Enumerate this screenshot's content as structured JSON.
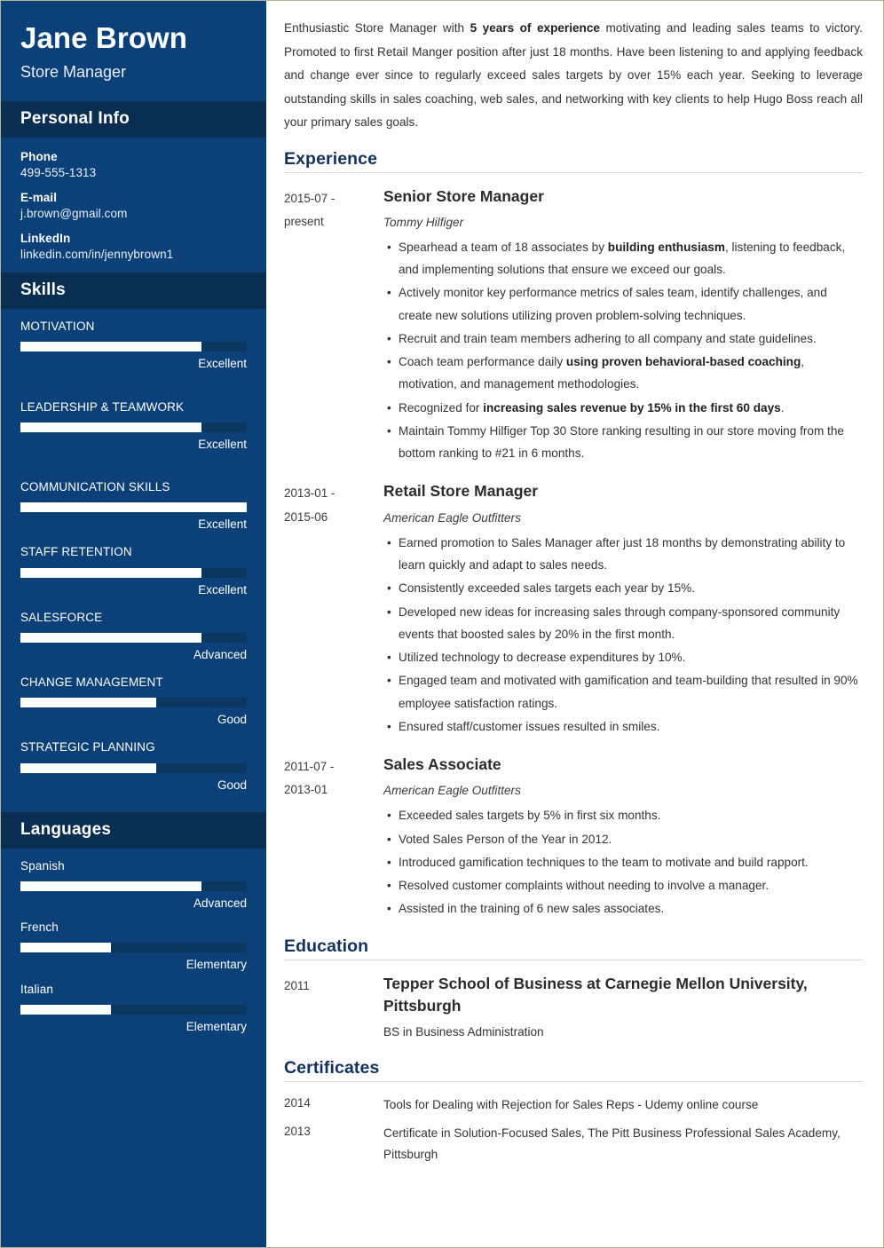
{
  "theme": {
    "sidebar_bg": "#0b4078",
    "sidebar_band_bg": "#0a2d52",
    "bar_track": "#0b365f",
    "bar_fill": "#ffffff",
    "heading_color": "#12325c",
    "body_text": "#333333",
    "page_border": "#b3b39a"
  },
  "sidebar": {
    "name": "Jane Brown",
    "job_title": "Store Manager",
    "personal_info_title": "Personal Info",
    "contacts": [
      {
        "label": "Phone",
        "value": "499-555-1313"
      },
      {
        "label": "E-mail",
        "value": "j.brown@gmail.com"
      },
      {
        "label": "LinkedIn",
        "value": "linkedin.com/in/jennybrown1"
      }
    ],
    "skills_title": "Skills",
    "skills": [
      {
        "name": "MOTIVATION",
        "level": "Excellent",
        "percent": 80
      },
      {
        "name": "LEADERSHIP & TEAMWORK",
        "level": "Excellent",
        "percent": 80
      },
      {
        "name": "COMMUNICATION SKILLS",
        "level": "Excellent",
        "percent": 100
      },
      {
        "name": "STAFF RETENTION",
        "level": "Excellent",
        "percent": 80
      },
      {
        "name": "SALESFORCE",
        "level": "Advanced",
        "percent": 80
      },
      {
        "name": "CHANGE MANAGEMENT",
        "level": "Good",
        "percent": 60
      },
      {
        "name": "STRATEGIC PLANNING",
        "level": "Good",
        "percent": 60
      }
    ],
    "languages_title": "Languages",
    "languages": [
      {
        "name": "Spanish",
        "level": "Advanced",
        "percent": 80
      },
      {
        "name": "French",
        "level": "Elementary",
        "percent": 40
      },
      {
        "name": "Italian",
        "level": "Elementary",
        "percent": 40
      }
    ]
  },
  "main": {
    "summary_parts": [
      {
        "text": "Enthusiastic Store Manager with ",
        "bold": false
      },
      {
        "text": "5 years of experience",
        "bold": true
      },
      {
        "text": " motivating and leading sales teams to victory. Promoted to first Retail Manger position after just 18 months. Have been listening to and applying feedback and change ever since to regularly exceed sales targets by over 15% each year. Seeking to leverage outstanding skills in sales coaching, web sales, and networking with key clients to help Hugo Boss reach all your primary sales goals.",
        "bold": false
      }
    ],
    "experience_title": "Experience",
    "experience": [
      {
        "date_line1": "2015-07 -",
        "date_line2": "present",
        "role": "Senior Store Manager",
        "company": "Tommy Hilfiger",
        "bullets": [
          [
            {
              "text": "Spearhead a team of 18 associates by ",
              "bold": false
            },
            {
              "text": "building enthusiasm",
              "bold": true
            },
            {
              "text": ", listening to feedback, and implementing solutions that ensure we exceed our goals.",
              "bold": false
            }
          ],
          [
            {
              "text": "Actively monitor key performance metrics of sales team, identify challenges, and create new solutions utilizing proven problem-solving techniques.",
              "bold": false
            }
          ],
          [
            {
              "text": "Recruit and train team members adhering to all company and state guidelines.",
              "bold": false
            }
          ],
          [
            {
              "text": "Coach team performance daily ",
              "bold": false
            },
            {
              "text": "using proven behavioral-based coaching",
              "bold": true
            },
            {
              "text": ", motivation, and management methodologies.",
              "bold": false
            }
          ],
          [
            {
              "text": "Recognized for ",
              "bold": false
            },
            {
              "text": "increasing sales revenue by 15% in the first 60 days",
              "bold": true
            },
            {
              "text": ".",
              "bold": false
            }
          ],
          [
            {
              "text": "Maintain Tommy Hilfiger Top 30 Store ranking resulting in our store moving from the bottom ranking to #21 in 6 months.",
              "bold": false
            }
          ]
        ]
      },
      {
        "date_line1": "2013-01 -",
        "date_line2": "2015-06",
        "role": "Retail Store Manager",
        "company": "American Eagle Outfitters",
        "bullets": [
          [
            {
              "text": "Earned promotion to Sales Manager after just 18 months by demonstrating ability to learn quickly and adapt to sales needs.",
              "bold": false
            }
          ],
          [
            {
              "text": "Consistently exceeded sales targets each year by 15%.",
              "bold": false
            }
          ],
          [
            {
              "text": "Developed new ideas for increasing sales through company-sponsored community events that boosted sales by 20% in the first month.",
              "bold": false
            }
          ],
          [
            {
              "text": "Utilized technology to decrease expenditures by 10%.",
              "bold": false
            }
          ],
          [
            {
              "text": "Engaged team and motivated with gamification and team-building that resulted in 90% employee satisfaction ratings.",
              "bold": false
            }
          ],
          [
            {
              "text": "Ensured staff/customer issues resulted in smiles.",
              "bold": false
            }
          ]
        ]
      },
      {
        "date_line1": "2011-07 -",
        "date_line2": "2013-01",
        "role": "Sales Associate",
        "company": "American Eagle Outfitters",
        "bullets": [
          [
            {
              "text": "Exceeded sales targets by 5% in first six months.",
              "bold": false
            }
          ],
          [
            {
              "text": "Voted Sales Person of the Year in 2012.",
              "bold": false
            }
          ],
          [
            {
              "text": "Introduced gamification techniques to the team to motivate and build rapport.",
              "bold": false
            }
          ],
          [
            {
              "text": "Resolved customer complaints without needing to involve a manager.",
              "bold": false
            }
          ],
          [
            {
              "text": "Assisted in the training of 6 new sales associates.",
              "bold": false
            }
          ]
        ]
      }
    ],
    "education_title": "Education",
    "education": [
      {
        "date": "2011",
        "school": "Tepper School of Business at Carnegie Mellon University, Pittsburgh",
        "degree": "BS in Business Administration"
      }
    ],
    "certificates_title": "Certificates",
    "certificates": [
      {
        "year": "2014",
        "text": "Tools for Dealing with Rejection for Sales Reps - Udemy online course"
      },
      {
        "year": "2013",
        "text": "Certificate in Solution-Focused Sales, The Pitt Business Professional Sales Academy, Pittsburgh"
      }
    ]
  }
}
